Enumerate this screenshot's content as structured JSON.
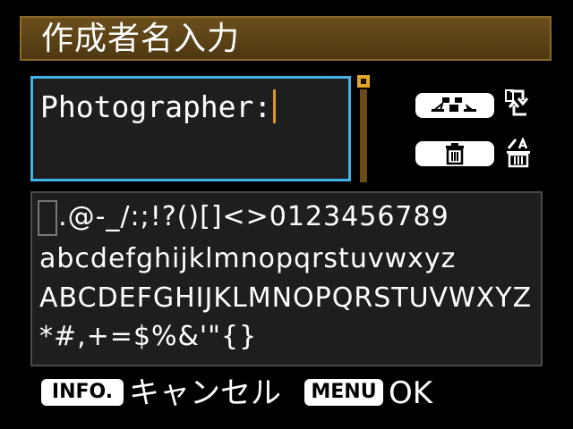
{
  "header": {
    "title": "作成者名入力"
  },
  "input": {
    "value": "Photographer:"
  },
  "side": {
    "toggle_icon": "keyboard-toggle-icon",
    "switch_icon": "switch-arrows-icon",
    "delete_icon": "trash-icon",
    "delete_all_icon": "delete-all-icon"
  },
  "charset": {
    "rows": [
      "  .@-_/:;!?()[]<>0123456789",
      "abcdefghijklmnopqrstuvwxyz",
      "ABCDEFGHIJKLMNOPQRSTUVWXYZ",
      "*#,+=$%&'\"{}"
    ]
  },
  "footer": {
    "info_badge": "INFO.",
    "cancel_label": "キャンセル",
    "menu_badge": "MENU",
    "ok_label": "OK"
  },
  "colors": {
    "title_bg": "#5c431a",
    "input_border": "#3fb4e6",
    "cursor": "#d89a28",
    "scroll": "#e3a628"
  }
}
